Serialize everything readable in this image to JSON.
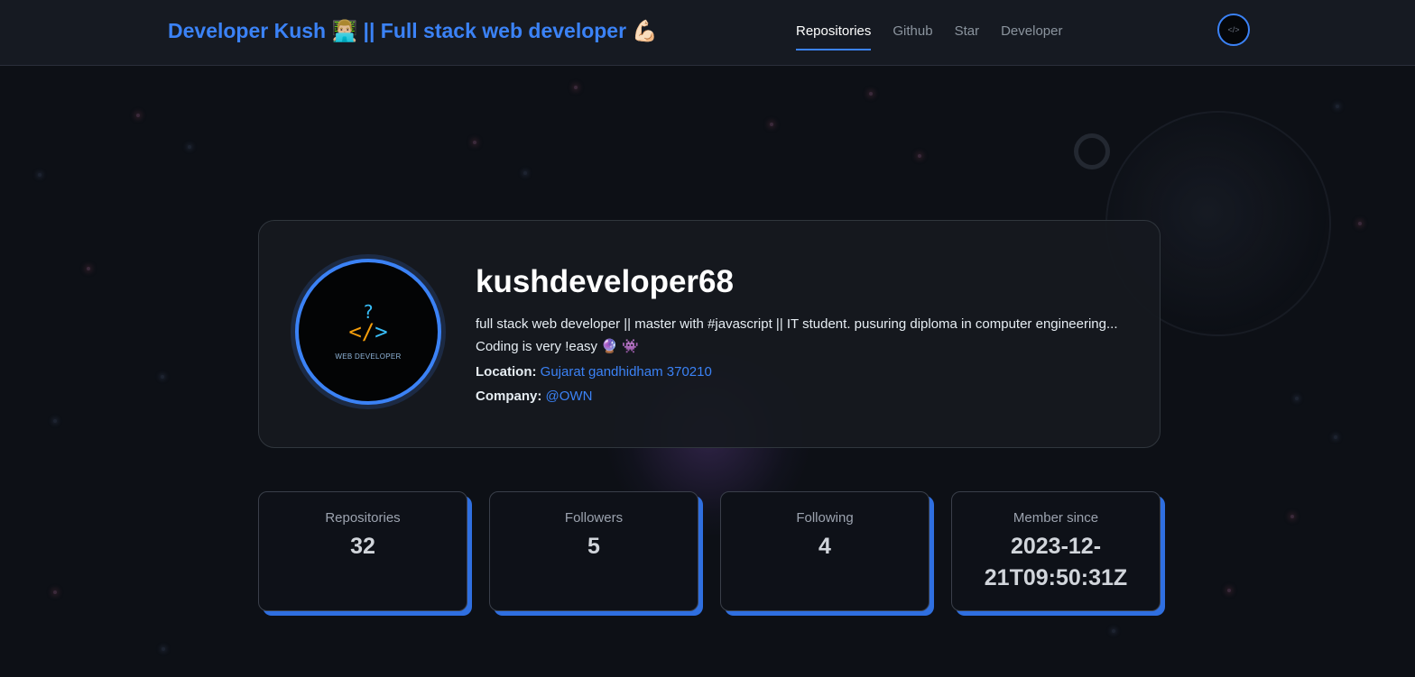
{
  "header": {
    "brand": "Developer Kush 👨🏼‍💻 || Full stack web developer 💪🏻",
    "nav": [
      {
        "label": "Repositories",
        "active": true
      },
      {
        "label": "Github",
        "active": false
      },
      {
        "label": "Star",
        "active": false
      },
      {
        "label": "Developer",
        "active": false
      }
    ]
  },
  "profile": {
    "username": "kushdeveloper68",
    "bio": "full stack web developer || master with #javascript || IT student. pusuring diploma in computer engineering... Coding is very !easy 🔮 👾",
    "location_label": "Location:",
    "location": "Gujarat gandhidham 370210",
    "company_label": "Company:",
    "company": "@OWN",
    "avatar_text": "WEB DEVELOPER"
  },
  "stats": [
    {
      "label": "Repositories",
      "value": "32"
    },
    {
      "label": "Followers",
      "value": "5"
    },
    {
      "label": "Following",
      "value": "4"
    },
    {
      "label": "Member since",
      "value": "2023-12-21T09:50:31Z"
    }
  ],
  "colors": {
    "accent": "#3b82f6",
    "background": "#0d1016",
    "card": "#161920"
  }
}
